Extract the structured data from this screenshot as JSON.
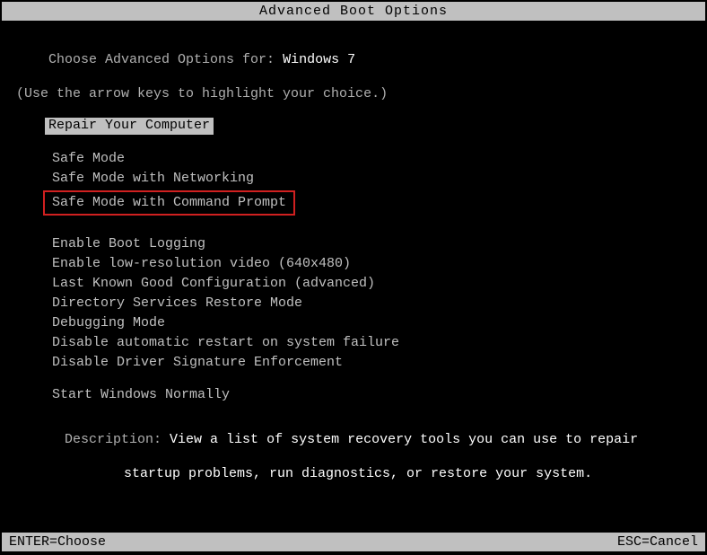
{
  "title": "Advanced Boot Options",
  "prompt_label": "Choose Advanced Options for: ",
  "os_name": "Windows 7",
  "instruction": "(Use the arrow keys to highlight your choice.)",
  "repair_option": "Repair Your Computer",
  "options_group1": [
    "Safe Mode",
    "Safe Mode with Networking",
    "Safe Mode with Command Prompt"
  ],
  "options_group2": [
    "Enable Boot Logging",
    "Enable low-resolution video (640x480)",
    "Last Known Good Configuration (advanced)",
    "Directory Services Restore Mode",
    "Debugging Mode",
    "Disable automatic restart on system failure",
    "Disable Driver Signature Enforcement"
  ],
  "options_group3": [
    "Start Windows Normally"
  ],
  "boxed_option": "Safe Mode with Command Prompt",
  "description_label": "Description: ",
  "description_text1": "View a list of system recovery tools you can use to repair",
  "description_text2": "startup problems, run diagnostics, or restore your system.",
  "footer_left": "ENTER=Choose",
  "footer_right": "ESC=Cancel"
}
